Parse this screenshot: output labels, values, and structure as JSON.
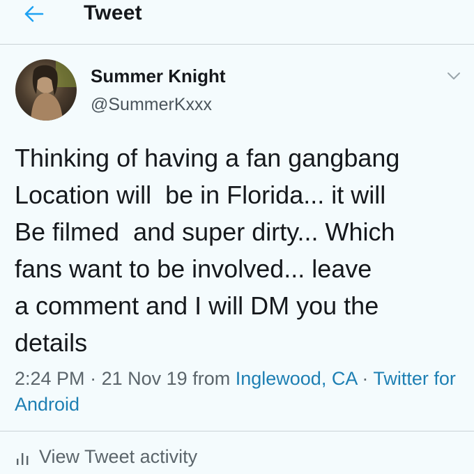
{
  "header": {
    "title": "Tweet",
    "back_icon": "arrow-left-icon",
    "accent": "#1da1f2"
  },
  "tweet": {
    "author_name": "Summer Knight",
    "author_handle": "@SummerKxxx",
    "more_icon": "chevron-down-icon",
    "text": "Thinking of having a fan gangbang\nLocation will  be in Florida... it will\nBe filmed  and super dirty... Which\nfans want to be involved... leave\na comment and I will DM you the\ndetails",
    "time": "2:24 PM",
    "date": "21 Nov 19",
    "from_label": "from",
    "location": "Inglewood, CA",
    "source": "Twitter for Android",
    "separator": "·",
    "link_color": "#1d7fb3"
  },
  "activity": {
    "label": "View Tweet activity",
    "icon": "bar-chart-icon"
  }
}
